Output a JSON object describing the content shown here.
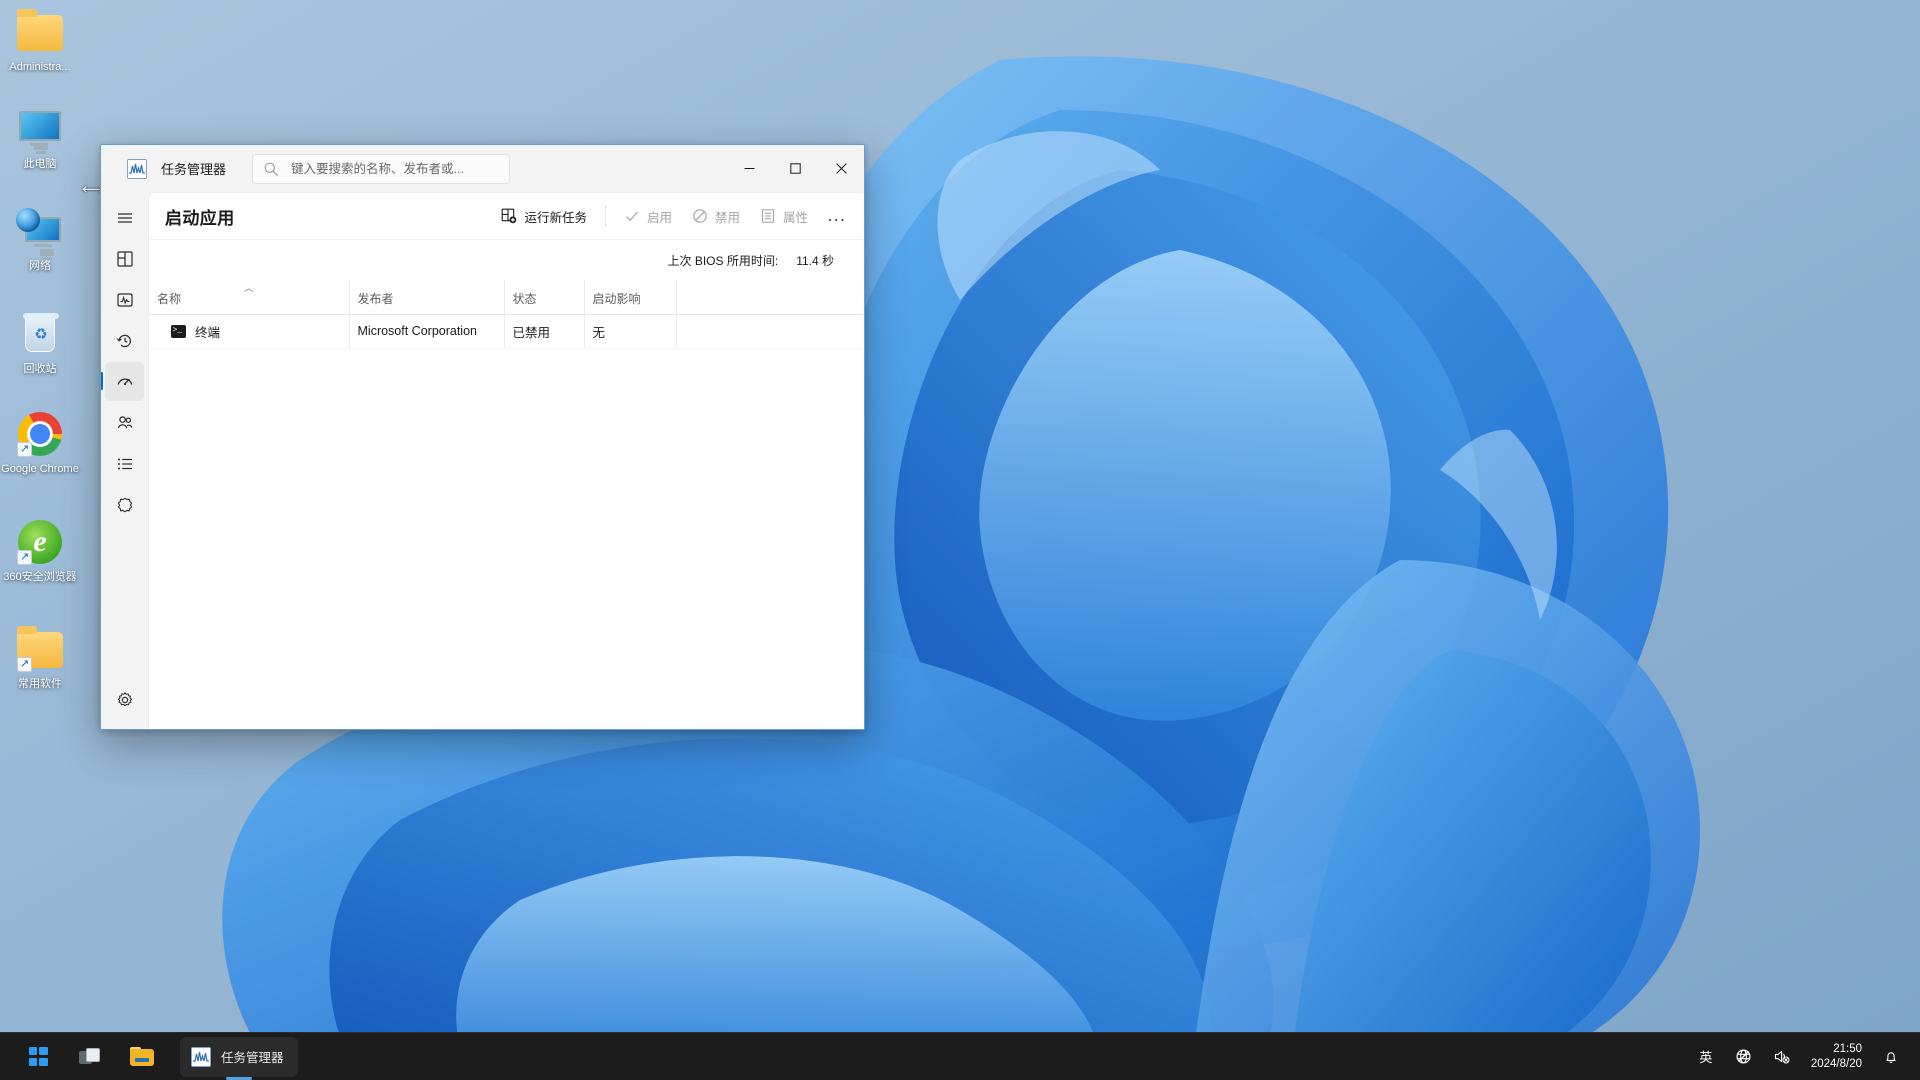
{
  "desktop": {
    "icons": [
      {
        "label": "Administra...",
        "icon": "folder-icon",
        "shortcut": false
      },
      {
        "label": "此电脑",
        "icon": "this-pc-icon",
        "shortcut": false
      },
      {
        "label": "网络",
        "icon": "network-icon",
        "shortcut": false
      },
      {
        "label": "回收站",
        "icon": "recycle-bin-icon",
        "shortcut": false
      },
      {
        "label": "Google Chrome",
        "icon": "chrome-icon",
        "shortcut": true
      },
      {
        "label": "360安全浏览器",
        "icon": "360-browser-icon",
        "shortcut": true
      },
      {
        "label": "常用软件",
        "icon": "folder-icon",
        "shortcut": true
      }
    ]
  },
  "window": {
    "title": "任务管理器",
    "app_icon": "task-manager-icon",
    "search": {
      "placeholder": "键入要搜索的名称、发布者或...",
      "value": "",
      "icon": "search-icon"
    },
    "controls": {
      "minimize": "minimize-icon",
      "maximize": "maximize-icon",
      "close": "close-icon"
    },
    "sidebar": [
      {
        "name": "hamburger-menu",
        "icon": "hamburger-icon",
        "active": false
      },
      {
        "name": "processes",
        "icon": "processes-grid-icon",
        "active": false
      },
      {
        "name": "performance",
        "icon": "performance-monitor-icon",
        "active": false
      },
      {
        "name": "app-history",
        "icon": "history-clock-icon",
        "active": false
      },
      {
        "name": "startup-apps",
        "icon": "startup-speedometer-icon",
        "active": true
      },
      {
        "name": "users",
        "icon": "users-icon",
        "active": false
      },
      {
        "name": "details",
        "icon": "details-list-icon",
        "active": false
      },
      {
        "name": "services",
        "icon": "services-gear-icon",
        "active": false
      },
      {
        "name": "settings",
        "icon": "settings-gear-icon",
        "active": false
      }
    ],
    "page_title": "启动应用",
    "commands": {
      "run_new_task": {
        "label": "运行新任务",
        "icon": "new-task-icon",
        "enabled": true
      },
      "enable": {
        "label": "启用",
        "icon": "checkmark-icon",
        "enabled": false
      },
      "disable": {
        "label": "禁用",
        "icon": "block-circle-icon",
        "enabled": false
      },
      "properties": {
        "label": "属性",
        "icon": "properties-icon",
        "enabled": false
      },
      "more": {
        "label": "...",
        "icon": "ellipsis-icon",
        "enabled": true
      }
    },
    "bios": {
      "label": "上次 BIOS 所用时间:",
      "value": "11.4 秒"
    },
    "table": {
      "columns": [
        {
          "label": "名称",
          "sorted": "asc"
        },
        {
          "label": "发布者",
          "sorted": null
        },
        {
          "label": "状态",
          "sorted": null
        },
        {
          "label": "启动影响",
          "sorted": null
        },
        {
          "label": "",
          "sorted": null
        }
      ],
      "rows": [
        {
          "name": "终端",
          "icon": "terminal-icon",
          "publisher": "Microsoft Corporation",
          "status": "已禁用",
          "impact": "无"
        }
      ]
    }
  },
  "taskbar": {
    "start": {
      "name": "start-button",
      "icon": "windows-logo-icon"
    },
    "taskview": {
      "name": "task-view-button",
      "icon": "task-view-icon"
    },
    "explorer": {
      "name": "file-explorer-button",
      "icon": "file-explorer-icon"
    },
    "active_app": {
      "label": "任务管理器",
      "icon": "task-manager-icon"
    },
    "tray": {
      "ime": "英",
      "network_icon": "network-disconnected-icon",
      "volume_icon": "volume-muted-icon",
      "time": "21:50",
      "date": "2024/8/20",
      "notification_icon": "bell-icon"
    }
  },
  "colors": {
    "accent": "#0f6cbd",
    "window_border": "#5fa0d8",
    "taskbar_bg": "#1c1c1c",
    "content_bg": "#ffffff",
    "chrome_bg": "#f3f3f3"
  }
}
